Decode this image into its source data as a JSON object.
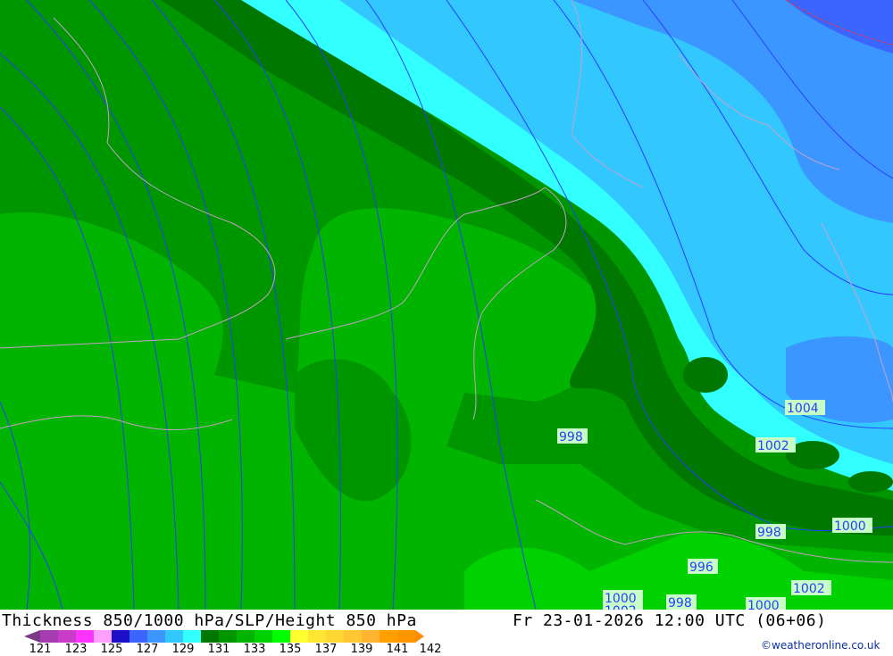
{
  "title": "Thickness 850/1000 hPa/SLP/Height 850 hPa",
  "valid_time": "Fr 23-01-2026 12:00 UTC (06+06)",
  "credit": "©weatheronline.co.uk",
  "legend": {
    "labels": [
      "121",
      "123",
      "125",
      "127",
      "129",
      "131",
      "133",
      "135",
      "137",
      "139",
      "141",
      "142"
    ],
    "colors": [
      "#7a3a86",
      "#a53cb0",
      "#c83cc8",
      "#ff33ff",
      "#ffa0ff",
      "#1e0fc8",
      "#3c64ff",
      "#3c96ff",
      "#32c8ff",
      "#32ffff",
      "#007800",
      "#009600",
      "#00b400",
      "#00d200",
      "#00ff00",
      "#ffff32",
      "#ffe632",
      "#ffd732",
      "#ffc832",
      "#ffb432",
      "#ffa000",
      "#ff9600",
      "#ff8c00"
    ]
  },
  "isobar_labels": [
    "998",
    "1004",
    "1002",
    "1000",
    "998",
    "996",
    "1002",
    "1000",
    "1002",
    "998",
    "1000"
  ]
}
